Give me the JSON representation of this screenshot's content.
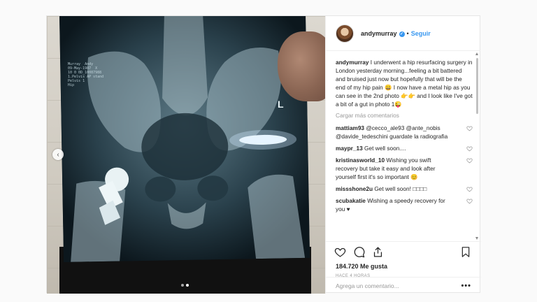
{
  "post": {
    "username": "andymurray",
    "follow_label": "Seguir",
    "separator": "•",
    "caption_user": "andymurray",
    "caption_text": " I underwent a hip resurfacing surgery in London yesterday morning...feeling a bit battered and bruised just now but hopefully that will be the end of my hip pain 😀 I now have a metal hip as you can see in the 2nd photo 👉👉 and I look like I've got a bit of a gut in photo 1😜",
    "load_more": "Cargar más comentarios",
    "likes": "184.720 Me gusta",
    "time": "HACE 4 HORAS",
    "comment_placeholder": "Agrega un comentario...",
    "more_icon": "•••"
  },
  "comments": [
    {
      "user": "mattiam93",
      "text": " @cecco_ale93 @ante_nobis @davide_tedeschini guardate la radiografia"
    },
    {
      "user": "maypr_13",
      "text": " Get well soon...."
    },
    {
      "user": "kristinasworld_10",
      "text": " Wishing you swift recovery but take it easy and look after yourself first it's so important 😊"
    },
    {
      "user": "missshone2u",
      "text": " Get well soon! □□□□"
    },
    {
      "user": "scubakatie",
      "text": " Wishing a speedy recovery for you ♥"
    }
  ],
  "xray": {
    "side_marker": "L",
    "header_text": "Murray  Andy\n09-May-1987  X\n10 0 0D_10087988\n1.Pelvis AP stand\nPelvis 1\nHip"
  },
  "carousel": {
    "prev_icon": "‹",
    "slides": 2,
    "active_index": 1
  },
  "icons": {
    "like": "heart-icon",
    "comment": "comment-bubble-icon",
    "share": "share-icon",
    "save": "bookmark-icon",
    "verified": "verified-badge-icon"
  },
  "colors": {
    "accent": "#3897f0",
    "muted": "#999999",
    "text": "#262626"
  }
}
